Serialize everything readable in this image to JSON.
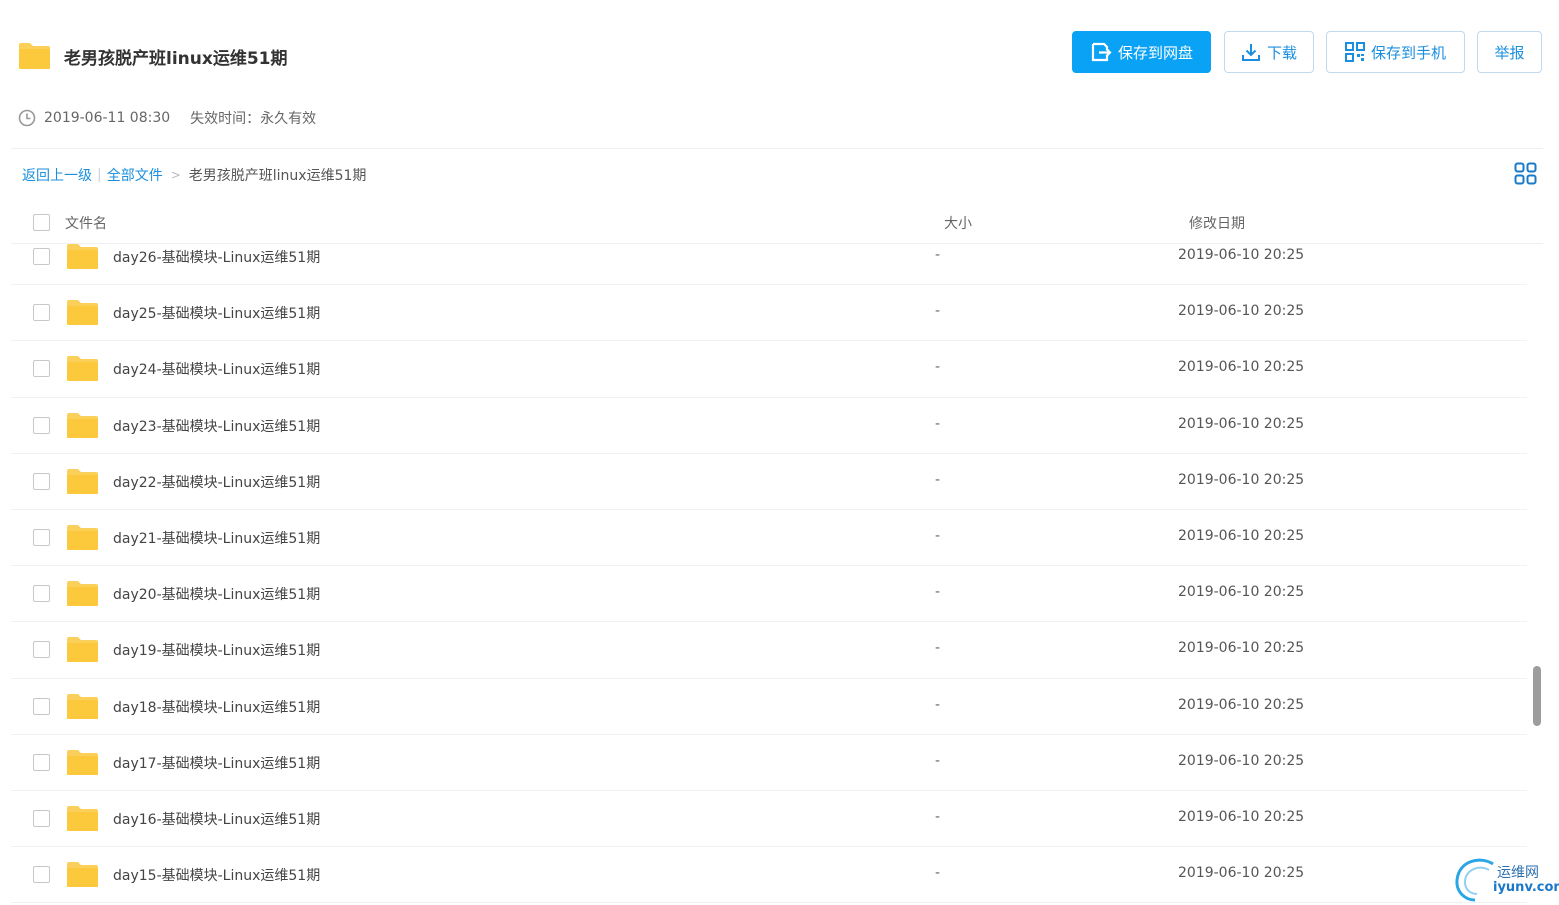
{
  "header": {
    "title": "老男孩脱产班linux运维51期",
    "buttons": {
      "save_to_disk": "保存到网盘",
      "download": "下载",
      "save_to_phone": "保存到手机",
      "report": "举报"
    }
  },
  "meta": {
    "created": "2019-06-11 08:30",
    "expire": "失效时间：永久有效"
  },
  "breadcrumb": {
    "back": "返回上一级",
    "separator": "|",
    "all_files": "全部文件",
    "arrow": ">",
    "current": "老男孩脱产班linux运维51期"
  },
  "columns": {
    "name": "文件名",
    "size": "大小",
    "date": "修改日期"
  },
  "files": [
    {
      "name": "day26-基础模块-Linux运维51期",
      "size": "-",
      "date": "2019-06-10 20:25"
    },
    {
      "name": "day25-基础模块-Linux运维51期",
      "size": "-",
      "date": "2019-06-10 20:25"
    },
    {
      "name": "day24-基础模块-Linux运维51期",
      "size": "-",
      "date": "2019-06-10 20:25"
    },
    {
      "name": "day23-基础模块-Linux运维51期",
      "size": "-",
      "date": "2019-06-10 20:25"
    },
    {
      "name": "day22-基础模块-Linux运维51期",
      "size": "-",
      "date": "2019-06-10 20:25"
    },
    {
      "name": "day21-基础模块-Linux运维51期",
      "size": "-",
      "date": "2019-06-10 20:25"
    },
    {
      "name": "day20-基础模块-Linux运维51期",
      "size": "-",
      "date": "2019-06-10 20:25"
    },
    {
      "name": "day19-基础模块-Linux运维51期",
      "size": "-",
      "date": "2019-06-10 20:25"
    },
    {
      "name": "day18-基础模块-Linux运维51期",
      "size": "-",
      "date": "2019-06-10 20:25"
    },
    {
      "name": "day17-基础模块-Linux运维51期",
      "size": "-",
      "date": "2019-06-10 20:25"
    },
    {
      "name": "day16-基础模块-Linux运维51期",
      "size": "-",
      "date": "2019-06-10 20:25"
    },
    {
      "name": "day15-基础模块-Linux运维51期",
      "size": "-",
      "date": "2019-06-10 20:25"
    }
  ],
  "watermark": {
    "cn": "运维网",
    "en": "iyunv.com"
  },
  "icons": {
    "folder": "folder-icon",
    "clock": "clock-icon",
    "save": "save-icon",
    "download": "download-icon",
    "qrcode": "qrcode-icon",
    "grid": "grid-view-icon"
  },
  "colors": {
    "primary": "#09a2f4",
    "link": "#1a8fe0",
    "folder": "#fbd05a"
  }
}
